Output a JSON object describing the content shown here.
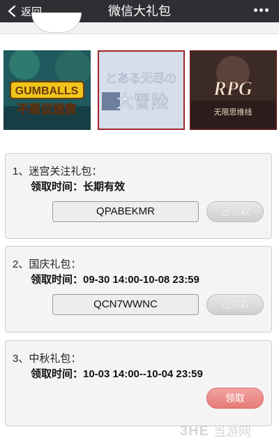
{
  "topbar": {
    "back_label": "返回",
    "title": "微信大礼包",
    "more_icon": "more-icon"
  },
  "banners": [
    {
      "name": "gumballs-banner",
      "lines": [
        "GUMBALLS",
        "不思议迷宫"
      ]
    },
    {
      "name": "toaru-banner",
      "lines": [
        "とある无尽の",
        "大冒险"
      ]
    },
    {
      "name": "rpg-banner",
      "lines": [
        "RPG",
        "无限思维线"
      ]
    }
  ],
  "gifts": [
    {
      "title": "1、迷宫关注礼包：",
      "time": "领取时间：长期有效",
      "code": "QPABEKMR",
      "button": "已领取",
      "status": "claimed"
    },
    {
      "title": "2、国庆礼包：",
      "time": "领取时间：09-30 14:00-10-08 23:59",
      "code": "QCN7WWNC",
      "button": "已领取",
      "status": "claimed"
    },
    {
      "title": "3、中秋礼包：",
      "time": "领取时间：10-03 14:00--10-04 23:59",
      "code": "",
      "button": "领取",
      "status": "available"
    }
  ],
  "watermark": {
    "logo": "3HE",
    "site": "当游网"
  },
  "colors": {
    "topbar": "#2e2e33",
    "claimed": "#cfcfcf",
    "claim": "#e67b77"
  }
}
